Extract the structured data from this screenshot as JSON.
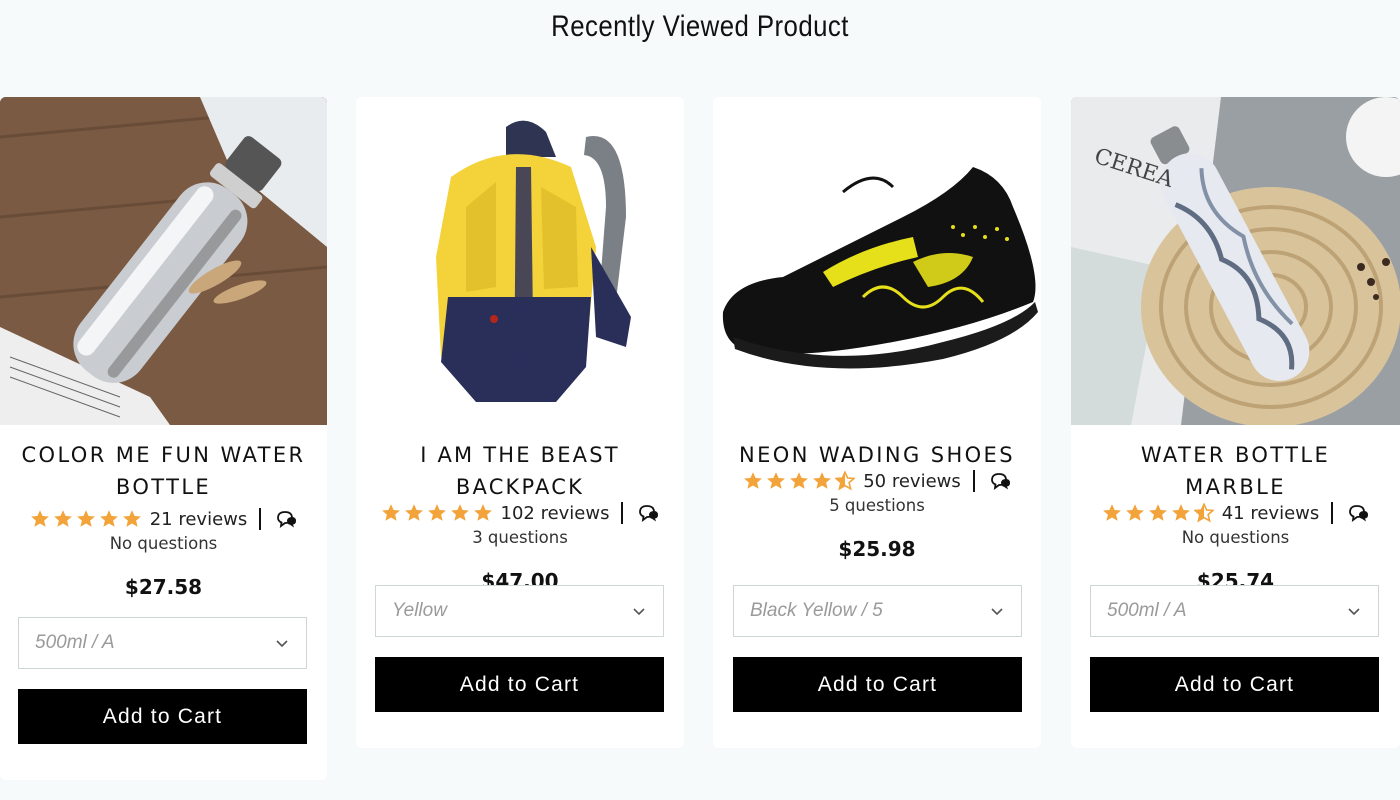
{
  "section": {
    "title": "Recently Viewed Product"
  },
  "colors": {
    "star": "#f2a33a",
    "button_bg": "#000000",
    "button_text": "#ffffff",
    "page_bg": "#f6fafb"
  },
  "products": [
    {
      "title": "COLOR ME FUN WATER BOTTLE",
      "rating": 5,
      "reviews": "21 reviews",
      "questions": "No questions",
      "price": "$27.58",
      "variant": "500ml / A",
      "cta": "Add to Cart",
      "image_icon": "silver-water-bottle-photo"
    },
    {
      "title": "I AM THE BEAST BACKPACK",
      "rating": 5,
      "reviews": "102 reviews",
      "questions": "3 questions",
      "price": "$47.00",
      "variant": "Yellow",
      "cta": "Add to Cart",
      "image_icon": "yellow-backpack-photo"
    },
    {
      "title": "NEON WADING SHOES",
      "rating": 4.5,
      "reviews": "50 reviews",
      "questions": "5 questions",
      "price": "$25.98",
      "variant": "Black Yellow / 5",
      "cta": "Add to Cart",
      "image_icon": "black-yellow-shoe-photo"
    },
    {
      "title": "WATER BOTTLE MARBLE",
      "rating": 4.5,
      "reviews": "41 reviews",
      "questions": "No questions",
      "price": "$25.74",
      "variant": "500ml / A",
      "cta": "Add to Cart",
      "image_icon": "marble-water-bottle-photo"
    }
  ]
}
